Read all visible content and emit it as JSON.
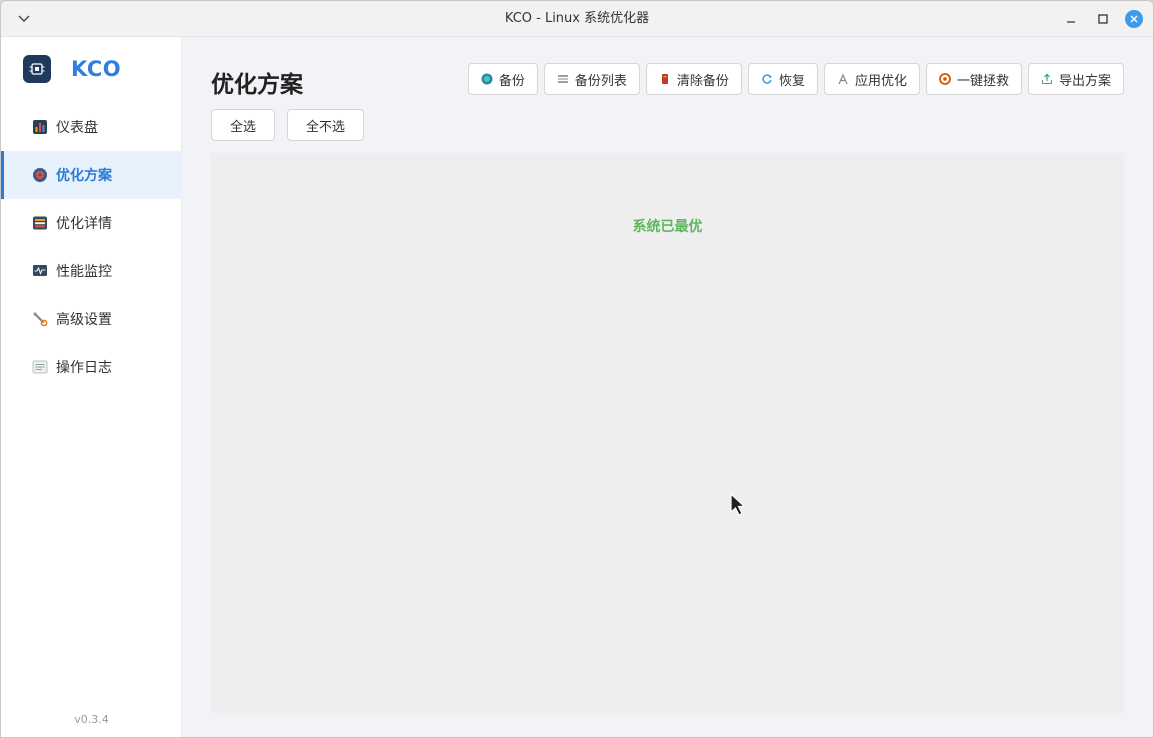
{
  "window": {
    "title": "KCO - Linux 系统优化器"
  },
  "sidebar": {
    "brand": "KCO",
    "version": "v0.3.4",
    "items": [
      {
        "label": "仪表盘",
        "icon": "dashboard-icon",
        "active": false
      },
      {
        "label": "优化方案",
        "icon": "target-icon",
        "active": true
      },
      {
        "label": "优化详情",
        "icon": "list-icon",
        "active": false
      },
      {
        "label": "性能监控",
        "icon": "monitor-icon",
        "active": false
      },
      {
        "label": "高级设置",
        "icon": "wrench-icon",
        "active": false
      },
      {
        "label": "操作日志",
        "icon": "log-icon",
        "active": false
      }
    ]
  },
  "main": {
    "title": "优化方案",
    "toolbar": [
      {
        "label": "备份",
        "icon": "backup-icon"
      },
      {
        "label": "备份列表",
        "icon": "stack-icon"
      },
      {
        "label": "清除备份",
        "icon": "trash-icon"
      },
      {
        "label": "恢复",
        "icon": "refresh-icon"
      },
      {
        "label": "应用优化",
        "icon": "apply-icon"
      },
      {
        "label": "一键拯救",
        "icon": "rescue-icon"
      },
      {
        "label": "导出方案",
        "icon": "export-icon"
      }
    ],
    "select_all": "全选",
    "select_none": "全不选",
    "status": "系统已最优"
  },
  "colors": {
    "accent": "#2a7ad8",
    "status_ok": "#5cb85c",
    "close_button": "#3d9be9"
  }
}
